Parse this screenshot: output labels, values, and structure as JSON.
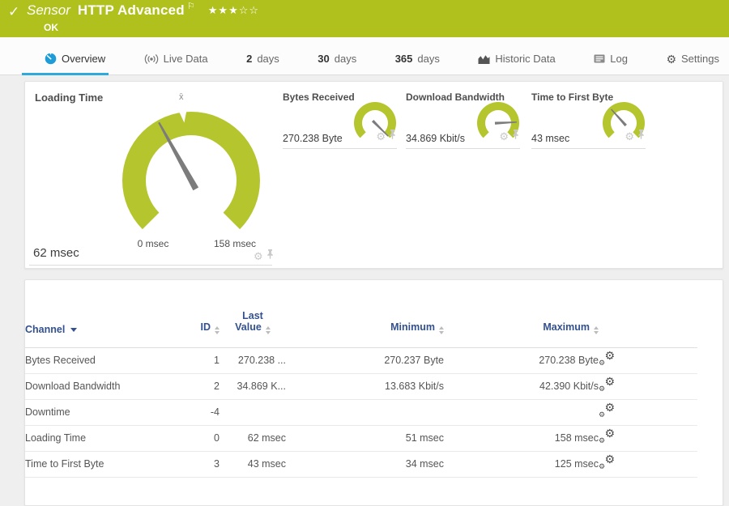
{
  "colors": {
    "header_bar": "#b0c11e",
    "gauge": "#b5c52e",
    "accent_blue": "#2ea9de",
    "table_header_blue": "#33518f"
  },
  "icons": {
    "check": "✓",
    "flag": "⚐",
    "stars_filled": "★★★",
    "stars_empty": "☆☆",
    "gear": "⚙",
    "mean_symbol": "x̄"
  },
  "header": {
    "kind": "Sensor",
    "title": "HTTP Advanced",
    "status": "OK"
  },
  "tabs": {
    "overview": {
      "label": "Overview"
    },
    "live_data": {
      "label": "Live Data"
    },
    "days2": {
      "num": "2",
      "unit": "days"
    },
    "days30": {
      "num": "30",
      "unit": "days"
    },
    "days365": {
      "num": "365",
      "unit": "days"
    },
    "historic": {
      "label": "Historic Data"
    },
    "log": {
      "label": "Log"
    },
    "settings": {
      "label": "Settings"
    }
  },
  "gauges": {
    "primary": {
      "title": "Loading Time",
      "value": 62,
      "min": 0,
      "max": 158,
      "mean": 75,
      "value_label": "62 msec",
      "min_label": "0 msec",
      "max_label": "158 msec"
    },
    "small": [
      {
        "title": "Bytes Received",
        "value": 270.238,
        "min": 0,
        "max": 270.238,
        "value_label": "270.238 Byte"
      },
      {
        "title": "Download Bandwidth",
        "value": 34.869,
        "min": 0,
        "max": 42.39,
        "value_label": "34.869 Kbit/s"
      },
      {
        "title": "Time to First Byte",
        "value": 43,
        "min": 0,
        "max": 125,
        "value_label": "43 msec"
      }
    ]
  },
  "table": {
    "columns": {
      "channel": "Channel",
      "id": "ID",
      "last_line1": "Last",
      "last_line2": "Value",
      "minimum": "Minimum",
      "maximum": "Maximum"
    },
    "rows": [
      {
        "channel": "Bytes Received",
        "id": "1",
        "last": "270.238 ...",
        "min": "270.237 Byte",
        "max": "270.238 Byte"
      },
      {
        "channel": "Download Bandwidth",
        "id": "2",
        "last": "34.869 K...",
        "min": "13.683 Kbit/s",
        "max": "42.390 Kbit/s"
      },
      {
        "channel": "Downtime",
        "id": "-4",
        "last": "",
        "min": "",
        "max": ""
      },
      {
        "channel": "Loading Time",
        "id": "0",
        "last": "62 msec",
        "min": "51 msec",
        "max": "158 msec"
      },
      {
        "channel": "Time to First Byte",
        "id": "3",
        "last": "43 msec",
        "min": "34 msec",
        "max": "125 msec"
      }
    ]
  }
}
